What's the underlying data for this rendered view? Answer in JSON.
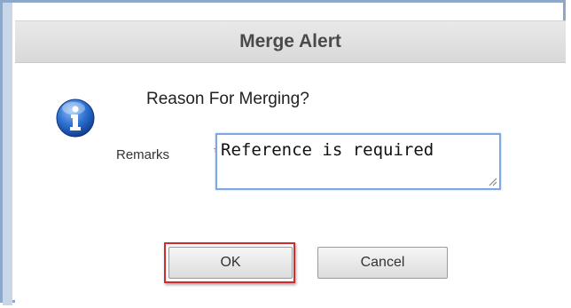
{
  "dialog": {
    "title": "Merge Alert",
    "question": "Reason For Merging?",
    "icon": "info-icon",
    "remarks": {
      "label": "Remarks",
      "required_marker": "*",
      "value": "Reference is required"
    },
    "buttons": {
      "ok_label": "OK",
      "cancel_label": "Cancel"
    }
  },
  "colors": {
    "title_bar": "#dedede",
    "frame": "#8da7c9",
    "required": "#d63b3b",
    "focus_border": "#7fa7e0",
    "highlight": "#d22b2b"
  }
}
